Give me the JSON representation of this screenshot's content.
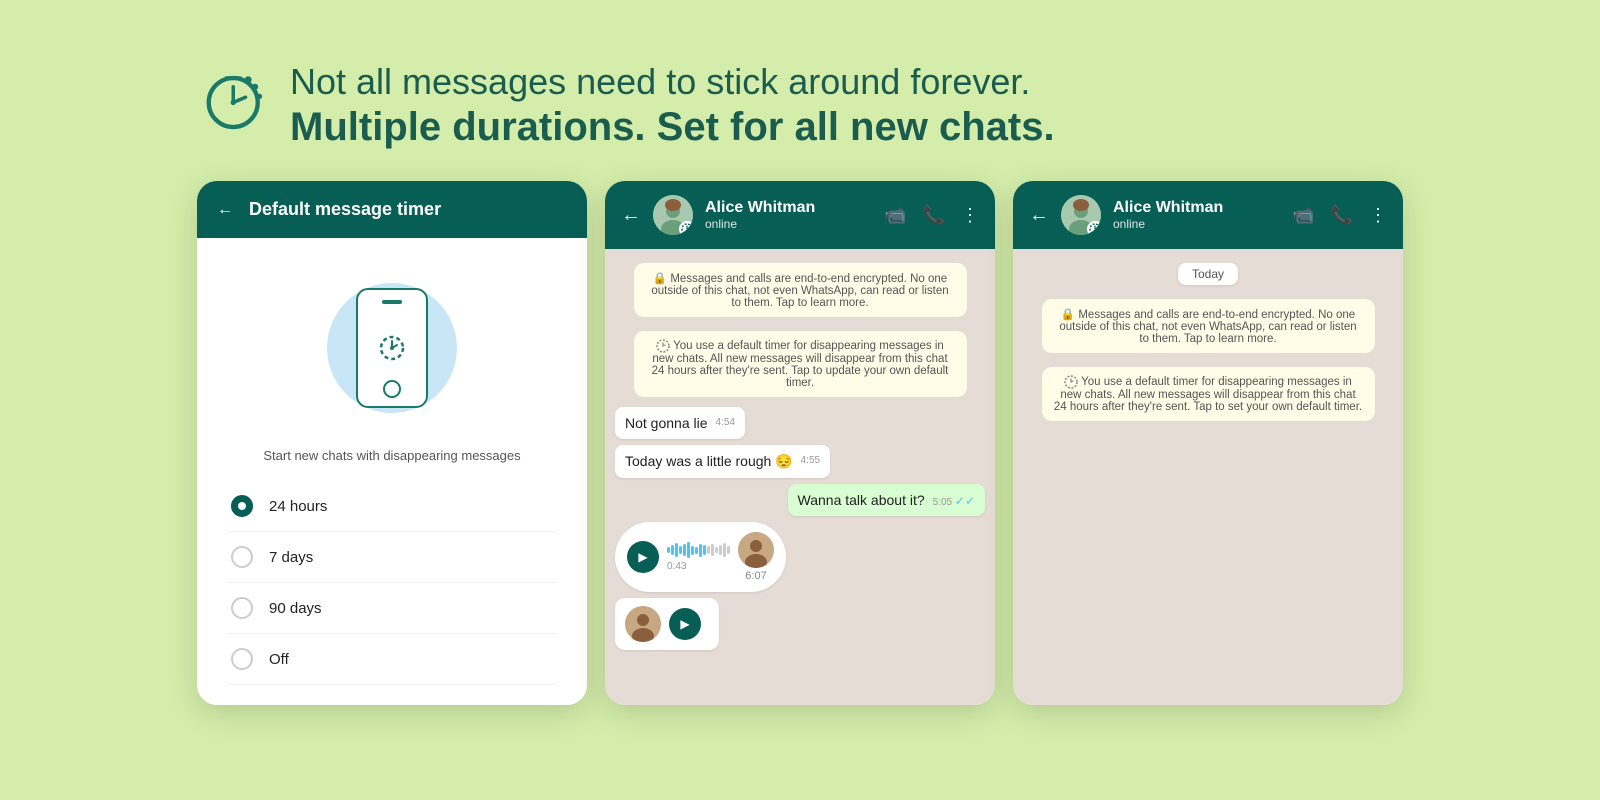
{
  "header": {
    "tagline": "Not all messages need to stick around forever.",
    "title": "Multiple durations. Set for all new chats.",
    "logo_title": "timer-logo"
  },
  "panel1": {
    "header_title": "Default message timer",
    "back_label": "←",
    "description": "Start new chats with disappearing messages",
    "options": [
      {
        "label": "24 hours",
        "selected": true
      },
      {
        "label": "7 days",
        "selected": false
      },
      {
        "label": "90 days",
        "selected": false
      },
      {
        "label": "Off",
        "selected": false
      }
    ]
  },
  "panel2": {
    "contact_name": "Alice Whitman",
    "contact_status": "online",
    "back_label": "←",
    "system_msg1": "🔒 Messages and calls are end-to-end encrypted. No one outside of this chat, not even WhatsApp, can read or listen to them. Tap to learn more.",
    "system_msg2": "⏱ You use a default timer for disappearing messages in new chats. All new messages will disappear from this chat 24 hours after they're sent. Tap to update your own default timer.",
    "msg1_text": "Not gonna lie",
    "msg1_time": "4:54",
    "msg2_text": "Today was a little rough 😔",
    "msg2_time": "4:55",
    "msg3_text": "Wanna talk about it?",
    "msg3_time": "5:05",
    "voice_time_elapsed": "0:43",
    "voice_time_sent": "6:07"
  },
  "panel3": {
    "contact_name": "Alice Whitman",
    "contact_status": "online",
    "back_label": "←",
    "today_label": "Today",
    "system_msg1": "🔒 Messages and calls are end-to-end encrypted. No one outside of this chat, not even WhatsApp, can read or listen to them. Tap to learn more.",
    "system_msg2": "⏱ You use a default timer for disappearing messages in new chats. All new messages will disappear from this chat 24 hours after they're sent. Tap to set your own default timer."
  },
  "colors": {
    "teal": "#075e54",
    "light_green_bg": "#d4edaa",
    "chat_bg": "#e5ddd5",
    "outgoing_bubble": "#d9fdd3",
    "incoming_bubble": "#ffffff"
  }
}
